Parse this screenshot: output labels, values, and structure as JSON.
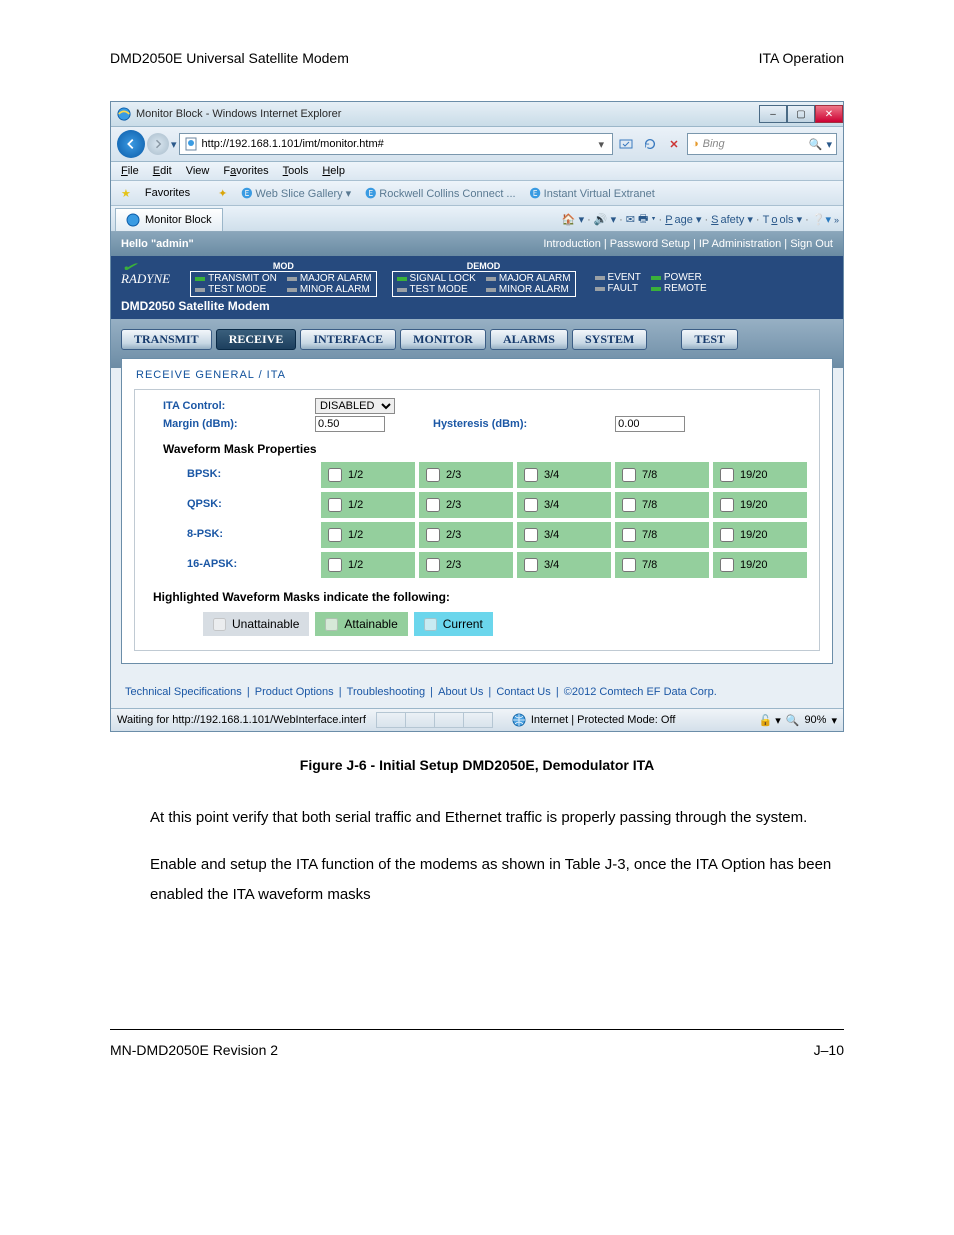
{
  "doc_header_left": "DMD2050E Universal Satellite Modem",
  "doc_header_right": "ITA Operation",
  "ie": {
    "title": "Monitor Block - Windows Internet Explorer",
    "url": "http://192.168.1.101/imt/monitor.htm#",
    "search_engine": "Bing",
    "menu": {
      "file": "File",
      "edit": "Edit",
      "view": "View",
      "favorites": "Favorites",
      "tools": "Tools",
      "help": "Help"
    },
    "favorites_label": "Favorites",
    "fav_links": {
      "web_slice": "Web Slice Gallery",
      "rockwell": "Rockwell Collins Connect ...",
      "extranet": "Instant Virtual Extranet"
    },
    "tab_title": "Monitor Block",
    "tab_icons": {
      "page": "Page",
      "safety": "Safety",
      "tools": "Tools"
    },
    "status_waiting": "Waiting for http://192.168.1.101/WebInterface.interf",
    "status_zone": "Internet | Protected Mode: Off",
    "status_zoom": "90%"
  },
  "modem": {
    "hello": "Hello \"admin\"",
    "header_links": "Introduction | Password Setup | IP Administration | Sign Out",
    "brand": "RADYNE",
    "name": "DMD2050 Satellite Modem",
    "mod_hdr": "MOD",
    "demod_hdr": "DEMOD",
    "mod": {
      "transmit_on": "TRANSMIT ON",
      "test_mode": "TEST MODE",
      "major": "MAJOR ALARM",
      "minor": "MINOR ALARM"
    },
    "demod": {
      "signal_lock": "SIGNAL LOCK",
      "test_mode": "TEST MODE",
      "major": "MAJOR ALARM",
      "minor": "MINOR ALARM"
    },
    "extra": {
      "event": "EVENT",
      "fault": "FAULT",
      "power": "POWER",
      "remote": "REMOTE"
    },
    "tabs": {
      "transmit": "TRANSMIT",
      "receive": "RECEIVE",
      "interface": "INTERFACE",
      "monitor": "MONITOR",
      "alarms": "ALARMS",
      "system": "SYSTEM",
      "test": "TEST"
    }
  },
  "panel": {
    "title": "RECEIVE GENERAL / ITA",
    "ita_control_label": "ITA Control:",
    "ita_control_value": "DISABLED",
    "margin_label": "Margin (dBm):",
    "margin_value": "0.50",
    "hysteresis_label": "Hysteresis (dBm):",
    "hysteresis_value": "0.00",
    "wf_title": "Waveform Mask Properties",
    "rows": [
      "BPSK:",
      "QPSK:",
      "8-PSK:",
      "16-APSK:"
    ],
    "rates": [
      "1/2",
      "2/3",
      "3/4",
      "7/8",
      "19/20"
    ],
    "highlight_note": "Highlighted Waveform Masks indicate the following:",
    "legend": {
      "un": "Unattainable",
      "at": "Attainable",
      "cu": "Current"
    }
  },
  "foot_links": {
    "specs": "Technical Specifications",
    "opts": "Product Options",
    "trouble": "Troubleshooting",
    "about": "About Us",
    "contact": "Contact Us",
    "copy": "©2012 Comtech EF Data Corp."
  },
  "caption": "Figure J-6 - Initial Setup DMD2050E, Demodulator ITA",
  "body1": "At this point verify that both serial traffic and Ethernet traffic is properly passing through the system.",
  "body2": "Enable and setup the ITA function of the modems as shown in Table J-3, once the ITA Option has been enabled the ITA waveform masks",
  "page_footer_left": "MN-DMD2050E   Revision 2",
  "page_footer_right": "J–10"
}
